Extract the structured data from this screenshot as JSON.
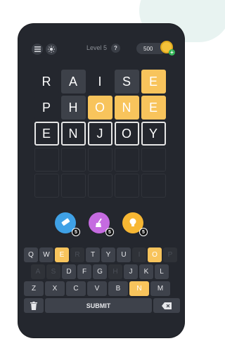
{
  "header": {
    "level": "Level 5",
    "help": "?",
    "coins": "500",
    "coin_plus": "+"
  },
  "board": {
    "rows": [
      [
        "R",
        "A",
        "I",
        "S",
        "E"
      ],
      [
        "P",
        "H",
        "O",
        "N",
        "E"
      ],
      [
        "E",
        "N",
        "J",
        "O",
        "Y"
      ],
      [
        "",
        "",
        "",
        "",
        ""
      ],
      [
        "",
        "",
        "",
        "",
        ""
      ]
    ]
  },
  "boosters": [
    {
      "name": "eraser",
      "count": "5",
      "color": "#3fa1e6"
    },
    {
      "name": "broom",
      "count": "5",
      "color": "#c56be0"
    },
    {
      "name": "hint-bulb",
      "count": "5",
      "color": "#f7b733"
    }
  ],
  "keyboard": {
    "row1": [
      "Q",
      "W",
      "E",
      "R",
      "T",
      "Y",
      "U",
      "I",
      "O",
      "P"
    ],
    "row2": [
      "A",
      "S",
      "D",
      "F",
      "G",
      "H",
      "J",
      "K",
      "L"
    ],
    "row3": [
      "Z",
      "X",
      "C",
      "V",
      "B",
      "N",
      "M"
    ],
    "submit": "SUBMIT"
  },
  "colors": {
    "accent": "#f8c45c",
    "panel": "#24272e",
    "key": "#3e424b"
  }
}
